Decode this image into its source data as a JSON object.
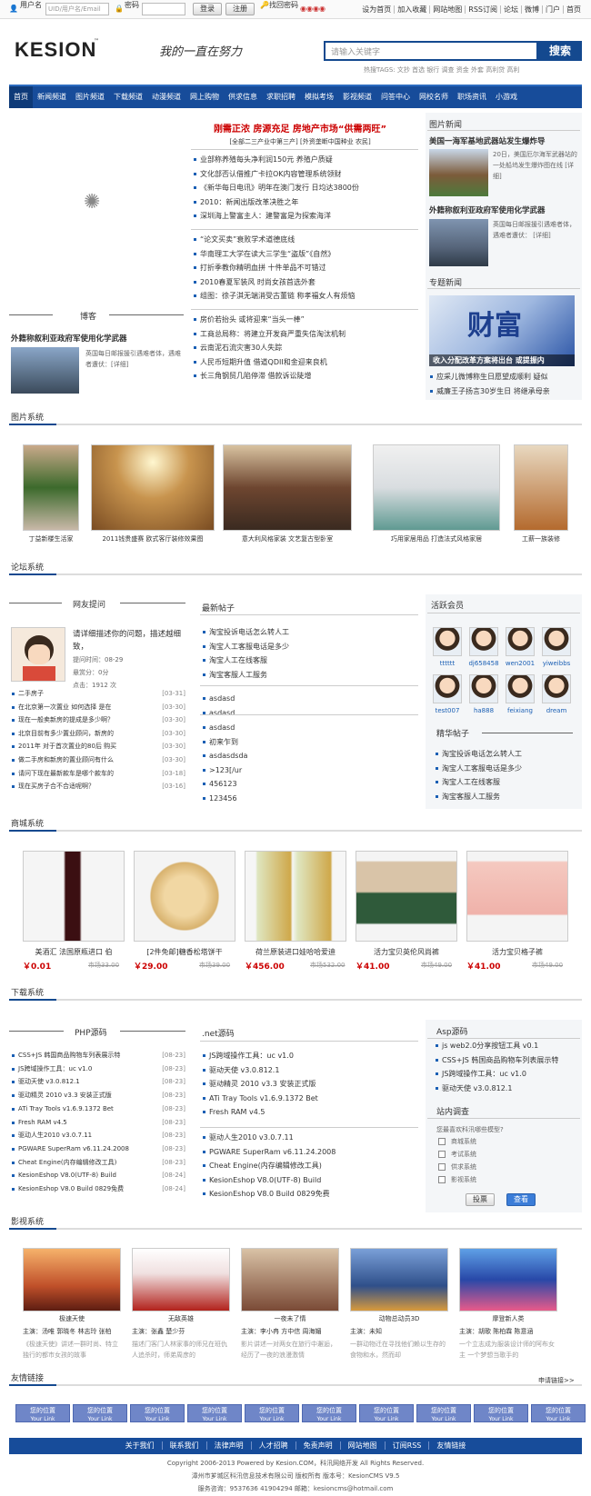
{
  "top": {
    "user_label": "用户名",
    "user_placeholder": "UID/用户名/Email",
    "pass_label": "密码",
    "login": "登录",
    "register": "注册",
    "find_pass": "找回密码",
    "links": [
      "设为首页",
      "加入收藏",
      "网站地图",
      "RSS订阅",
      "论坛",
      "微博",
      "门户",
      "首页"
    ]
  },
  "header": {
    "logo": "KESION",
    "slogan": "我的一直在努力",
    "search_placeholder": "请输入关键字",
    "search_btn": "搜索",
    "hot_tags": "热搜TAGS: 文抄 首选 银行 调查 资金 外套 高利贷 高利"
  },
  "nav": [
    "首页",
    "新闻频道",
    "图片频道",
    "下载频道",
    "动漫频道",
    "网上购物",
    "供求信息",
    "求职招聘",
    "模拟考场",
    "影视频道",
    "问答中心",
    "网校名师",
    "职场资讯",
    "小游戏"
  ],
  "news": {
    "headline": "刚需正浓 房源充足 房地产市场“供需两旺”",
    "subhead": "[全部二三产业中第三产] [外资垄断中国种业 农民]",
    "group1": [
      "业部称养殖每头净利润150元 养殖户质疑",
      "文化部否认借推广卡拉OK内容管理系统领财",
      "《新华每日电讯》明年在澳门发行 日均达3800份",
      "2010：新闻出版改革决胜之年",
      "深圳海上警富主人：建警富是为探索海洋"
    ],
    "group2": [
      "“论文买卖”衰败学术道德底线",
      "华南理工大学在读大三学生“盗版”《自然》",
      "打折季教你精明血拼 十件单品不可错过",
      "2010春夏军装风 时尚女孩首选外套",
      "组图：徐子淇无端消受古董链 称孝福女人有烦恼"
    ],
    "group3": [
      "房价若抬头 或将迎来“当头一棒”",
      "工商总局称：将建立开发商严重失信淘汰机制",
      "云南泥石流灾害30人失踪",
      "人民币短期升值 借道QDII和金迎来良机",
      "长三角钢贸几陷停滞 借款诉讼陡增"
    ]
  },
  "blog": {
    "title": "博客",
    "article_title": "外籍称叙利亚政府军使用化学武器",
    "article_desc": "英国每日邮报援引遇难者体，遇难者遭伏：[详细]"
  },
  "picnews": {
    "title": "图片新闻",
    "item1_title": "美国一海军基地武器站发生爆炸导",
    "item1_desc": "20日，美国厄尔海军武器站的一处船坞发生爆炸图在线 [详细]",
    "item2_title": "外籍称叙利亚政府军使用化学武器",
    "item2_desc": "英国每日邮报援引遇难者体，遇难者遭伏： [详细]"
  },
  "topic": {
    "title": "专题新闻",
    "banner_text": "财富",
    "banner_caption": "收入分配改革方案将出台 或提振内",
    "links": [
      "应采儿微博称生日愿望成顺利 疑似",
      "威廉王子扬言30岁生日 将继承母亲"
    ]
  },
  "gallery": {
    "title": "图片系统",
    "items": [
      "丁益新楼生活家",
      "2011钱贵盛赛 欧式客厅装修效果图",
      "意大利风格家装 文艺复古型卧室",
      "巧用家居用品 打造法式风格家居",
      "工薪一族装修"
    ]
  },
  "forum": {
    "title": "论坛系统",
    "ask_title": "网友提问",
    "ask_question": "请详细描述你的问题，描述越细致，",
    "ask_time": "提问时间：08-29",
    "ask_reward": "悬赏分：0分",
    "ask_clicks": "点击：1912 次",
    "ask_list": [
      [
        "二手房子",
        "[03-31]"
      ],
      [
        "在北京第一次置业 如何选择 是在",
        "[03-30]"
      ],
      [
        "现在一般卖新房的提成是多少啊？",
        "[03-30]"
      ],
      [
        "北京目前有多少置业顾问，新房的",
        "[03-30]"
      ],
      [
        "2011年 对于首次置业的80后 购买",
        "[03-30]"
      ],
      [
        "做二手房和新房的置业顾问有什么",
        "[03-30]"
      ],
      [
        "请问下现在最新款车是哪个款车的",
        "[03-18]"
      ],
      [
        "现在买房子合不合适呢啊？",
        "[03-16]"
      ]
    ],
    "latest_title": "最新帖子",
    "latest1": [
      "淘宝投诉电话怎么转人工",
      "淘宝人工客服电话是多少",
      "淘宝人工在线客服",
      "淘宝客服人工服务"
    ],
    "latest2": [
      "asdasd",
      "asdasd"
    ],
    "latest3": [
      "asdasd",
      "初来乍到",
      "asdasdsda",
      "&gt;123[/ur",
      "456123",
      "123456"
    ],
    "members_title": "活跃会员",
    "members": [
      "tttttt",
      "dj658458",
      "wen2001",
      "yiweibbs",
      "test007",
      "ha888",
      "feixiang",
      "dream"
    ],
    "hot_title": "精华帖子",
    "hot": [
      "淘宝投诉电话怎么转人工",
      "淘宝人工客服电话是多少",
      "淘宝人工在线客服",
      "淘宝客服人工服务"
    ]
  },
  "shop": {
    "title": "商城系统",
    "items": [
      {
        "name": "美酒汇 法国原瓶进口 伯",
        "price": "￥0.01",
        "mprice": "市场33.00"
      },
      {
        "name": "[2件免邮]糖香松塔饼干",
        "price": "￥29.00",
        "mprice": "市场39.00"
      },
      {
        "name": "荷兰原装进口娃哈哈爱迪",
        "price": "￥456.00",
        "mprice": "市场532.00"
      },
      {
        "name": "活力宝贝英伦风尚裤",
        "price": "￥41.00",
        "mprice": "市场49.00"
      },
      {
        "name": "活力宝贝格子裤",
        "price": "￥41.00",
        "mprice": "市场49.00"
      }
    ]
  },
  "download": {
    "title": "下载系统",
    "php_title": "PHP源码",
    "php": [
      [
        "CSS+JS 韩国商品购物车列表展示特",
        "[08-23]"
      ],
      [
        "JS跨域操作工具：uc v1.0",
        "[08-23]"
      ],
      [
        "驱动天使 v3.0.812.1",
        "[08-23]"
      ],
      [
        "驱动精灵 2010 v3.3 安装正式版",
        "[08-23]"
      ],
      [
        "ATi Tray Tools v1.6.9.1372 Bet",
        "[08-23]"
      ],
      [
        "Fresh RAM v4.5",
        "[08-23]"
      ],
      [
        "驱动人生2010 v3.0.7.11",
        "[08-23]"
      ],
      [
        "PGWARE SuperRam v6.11.24.2008",
        "[08-23]"
      ],
      [
        "Cheat Engine(内存编辑修改工具)",
        "[08-23]"
      ],
      [
        "KesionEshop V8.0(UTF-8) Build",
        "[08-24]"
      ],
      [
        "KesionEshop V8.0 Build 0829免费",
        "[08-24]"
      ]
    ],
    "net_title": ".net源码",
    "net1": [
      "JS跨域操作工具：uc v1.0",
      "驱动天使 v3.0.812.1",
      "驱动精灵 2010 v3.3 安装正式版",
      "ATi Tray Tools v1.6.9.1372 Bet",
      "Fresh RAM v4.5"
    ],
    "net2": [
      "驱动人生2010 v3.0.7.11",
      "PGWARE SuperRam v6.11.24.2008",
      "Cheat Engine(内存编辑修改工具)",
      "KesionEshop V8.0(UTF-8) Build",
      "KesionEshop V8.0 Build 0829免费"
    ],
    "asp_title": "Asp源码",
    "asp": [
      "js web2.0分享按钮工具 v0.1",
      "CSS+JS 韩国商品购物车列表展示特",
      "JS跨域操作工具：uc v1.0",
      "驱动天使 v3.0.812.1"
    ],
    "poll_title": "站内调查",
    "poll_q": "您最喜欢科汛哪些模型?",
    "poll_opts": [
      "商城系统",
      "考试系统",
      "供求系统",
      "影视系统"
    ],
    "vote": "投票",
    "view": "查看"
  },
  "movie": {
    "title": "影视系统",
    "items": [
      {
        "name": "极速天使",
        "star": "主演：汤唯 郭晓冬 林志玲 张柏",
        "desc": "《极速天使》讲述一群时尚、特立独行的都市女孩的故事"
      },
      {
        "name": "无敌英雄",
        "star": "主演：张鑫 楚少芬",
        "desc": "描述门客门人林家事的师兄在班仇人追杀时，师弟周彦的"
      },
      {
        "name": "一夜未了情",
        "star": "主演：李小冉 方中信 周海媚",
        "desc": "影片讲述一对两女在旅行中邂逅，经历了一夜的浪漫激情"
      },
      {
        "name": "动物总动员3D",
        "star": "主演：未知",
        "desc": "一群动物迁在寻找他们赖以生存的食物和水，然而却"
      },
      {
        "name": "摩登新人类",
        "star": "主演：胡歌 陈柏霖 陈意涵",
        "desc": "一个立志成为服装设计师的阿布女主 一个梦想当歌手的"
      }
    ]
  },
  "friends": {
    "title": "友情链接",
    "apply": "申请链接>>",
    "badge": "您的位置",
    "badge_sub": "Your Link"
  },
  "footer": {
    "links": [
      "关于我们",
      "联系我们",
      "法律声明",
      "人才招聘",
      "免责声明",
      "网站地图",
      "订阅RSS",
      "友情链接"
    ],
    "copyright": "Copyright 2006-2013 Powered by Kesion.COM，科汛网络开发 All Rights Reserved.",
    "company": "漳州市芗城区科汛信息技术有限公司 版权所有 版本号：KesionCMS V9.5",
    "contact": "服务咨询：9537636 41904294 邮箱：kesioncms@hotmail.com"
  }
}
